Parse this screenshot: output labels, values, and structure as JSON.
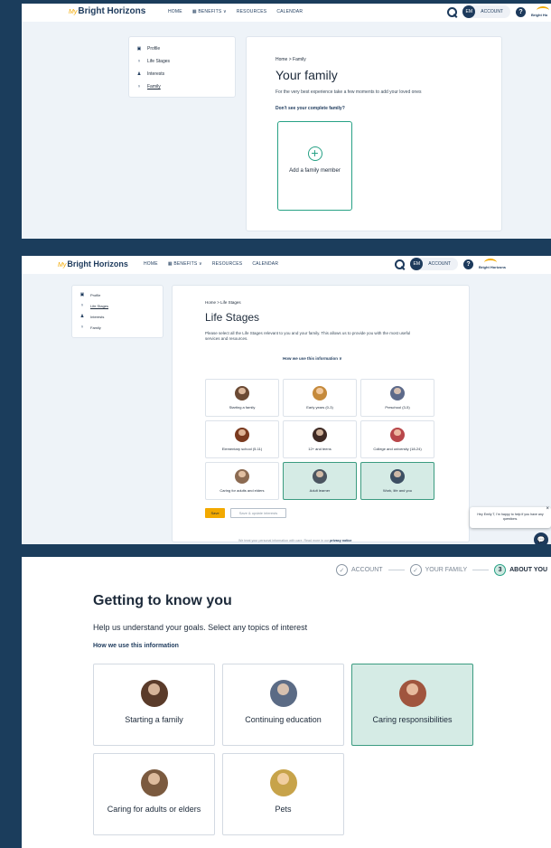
{
  "panel1": {
    "nav": {
      "logo_prefix": "My",
      "logo": "Bright Horizons",
      "home": "HOME",
      "benefits": "BENEFITS ∨",
      "resources": "RESOURCES",
      "calendar": "CALENDAR",
      "avatar": "EM",
      "account": "ACCOUNT",
      "help": "?",
      "brand": "Bright Ho"
    },
    "sidebar": [
      {
        "label": "Profile",
        "icon": "id-card-icon"
      },
      {
        "label": "Life Stages",
        "icon": "stroller-icon"
      },
      {
        "label": "Interests",
        "icon": "person-icon"
      },
      {
        "label": "Family",
        "icon": "stroller-icon"
      }
    ],
    "breadcrumb": "Home > Family",
    "title": "Your family",
    "subtitle": "For the very best experience take a few moments to add your loved ones",
    "link": "Don't see your complete family?",
    "add_plus": "+",
    "add_label": "Add a family member"
  },
  "panel2": {
    "nav": {
      "logo_prefix": "My",
      "logo": "Bright Horizons",
      "home": "HOME",
      "benefits": "BENEFITS ∨",
      "resources": "RESOURCES",
      "calendar": "CALENDAR",
      "avatar": "EM",
      "account": "ACCOUNT",
      "help": "?",
      "brand": "Bright Horizons"
    },
    "sidebar": [
      {
        "label": "Profile"
      },
      {
        "label": "Life Stages"
      },
      {
        "label": "Interests"
      },
      {
        "label": "Family"
      }
    ],
    "breadcrumb": "Home > Life Stages",
    "title": "Life Stages",
    "subtitle": "Please select all the Life Stages relevant to you and your family. This allows us to provide you with the most useful services and resources.",
    "how": "How we use this information ∨",
    "tiles": [
      {
        "label": "Starting a family",
        "selected": false,
        "color": "#6b4a34"
      },
      {
        "label": "Early years (0-3)",
        "selected": false,
        "color": "#c58a3c"
      },
      {
        "label": "Preschool (3-5)",
        "selected": false,
        "color": "#5d6a8a"
      },
      {
        "label": "Elementary school (5-11)",
        "selected": false,
        "color": "#7a3a1f"
      },
      {
        "label": "12+ and teens",
        "selected": false,
        "color": "#3f2a24"
      },
      {
        "label": "College and university (18-24)",
        "selected": false,
        "color": "#b8474a"
      },
      {
        "label": "Caring for adults and elders",
        "selected": false,
        "color": "#8c6b52"
      },
      {
        "label": "Adult learner",
        "selected": true,
        "color": "#4b5560"
      },
      {
        "label": "Work, life and you",
        "selected": true,
        "color": "#3d4f63"
      }
    ],
    "save": "Save",
    "skip": "Save & update interests",
    "chat": "Hey Emily T, I'm happy to help if you have any questions.",
    "chat_close": "×",
    "chat_icon": "💬",
    "footer": "We treat your personal information with care. Read more in our",
    "footer_link": "privacy notice"
  },
  "panel3": {
    "steps": [
      {
        "label": "ACCOUNT",
        "mark": "✓"
      },
      {
        "label": "YOUR FAMILY",
        "mark": "✓"
      },
      {
        "label": "ABOUT YOU",
        "mark": "3"
      }
    ],
    "title": "Getting to know you",
    "subtitle": "Help us understand your goals. Select any topics of interest",
    "link": "How we use this information",
    "tiles": [
      {
        "label": "Starting a family",
        "selected": false,
        "color": "#5a3b2a"
      },
      {
        "label": "Continuing education",
        "selected": false,
        "color": "#5b6b85"
      },
      {
        "label": "Caring responsibilities",
        "selected": true,
        "color": "#a0553e"
      },
      {
        "label": "Caring for adults or elders",
        "selected": false,
        "color": "#7b5a3f"
      },
      {
        "label": "Pets",
        "selected": false,
        "color": "#c7a34a"
      }
    ]
  }
}
